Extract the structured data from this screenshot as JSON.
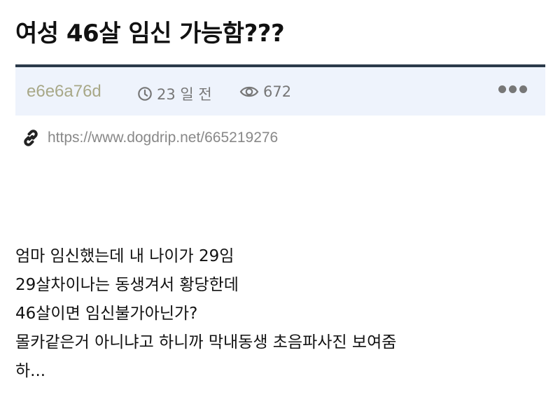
{
  "post": {
    "title": "여성 46살 임신 가능함???",
    "author": "e6e6a76d",
    "time": "23 일 전",
    "views": "672",
    "url": "https://www.dogdrip.net/665219276",
    "lines": [
      "엄마 임신했는데 내 나이가 29임",
      "29살차이나는 동생겨서 황당한데",
      "46살이면 임신불가아닌가?",
      "몰카같은거 아니냐고 하니까 막내동생 초음파사진 보여줌",
      "하..."
    ]
  },
  "icons": {
    "time": "clock-icon",
    "views": "eye-icon",
    "link": "link-icon",
    "more": "more-dots-icon"
  },
  "colors": {
    "meta_bg": "#eef3fc",
    "meta_border": "#2b3a4a",
    "author": "#a8a888",
    "muted": "#777777"
  }
}
